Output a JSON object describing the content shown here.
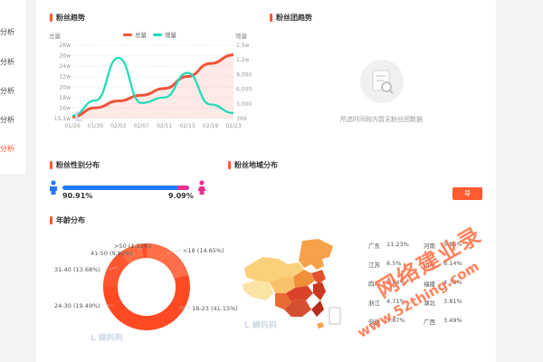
{
  "sidebar": {
    "items": [
      {
        "label": "分析"
      },
      {
        "label": "分析"
      },
      {
        "label": "分析"
      },
      {
        "label": "分析"
      },
      {
        "label": "分析"
      }
    ]
  },
  "sections": {
    "fans_trend": "粉丝趋势",
    "fans_group": "粉丝团趋势",
    "gender": "粉丝性别分布",
    "region": "粉丝地域分布",
    "age": "年龄分布"
  },
  "trend_chart": {
    "left_axis_title": "总量",
    "right_axis_title": "增量",
    "legend_total": "总量",
    "legend_increase": "增量",
    "left_ticks": [
      "28w",
      "26w",
      "24w",
      "22w",
      "20w",
      "18w",
      "16w",
      "15.1w"
    ],
    "right_ticks": [
      "1.5w",
      "1.2w",
      "9,000",
      "6,000",
      "3,000",
      "399"
    ],
    "x_ticks": [
      "01/26",
      "01/30",
      "02/03",
      "02/07",
      "02/11",
      "02/15",
      "02/19",
      "02/23"
    ],
    "colors": {
      "total": "#f0533a",
      "increase": "#21d9b8"
    }
  },
  "fans_group": {
    "empty_message": "所选时间段内暂无粉丝团数据"
  },
  "gender": {
    "male_percent": "90.91%",
    "female_percent": "9.09%",
    "male_value": 90.91,
    "colors": {
      "male": "#1f7bf7",
      "female": "#e8308f"
    }
  },
  "export_button": "导",
  "age": {
    "labels": [
      ">50 (1.21%)",
      "41-50 (9.82%)",
      "31-40 (13.68%)",
      "24-30 (19.49%)",
      "18-23 (41.15%)",
      "<18 (14.65%)"
    ]
  },
  "region_table": [
    {
      "name": "广东",
      "value": "11.23%",
      "name2": "河南",
      "value2": "5.86%"
    },
    {
      "name": "江苏",
      "value": "6.5%",
      "name2": "山东",
      "value2": "6.14%"
    },
    {
      "name": "四川",
      "value": "5.94%",
      "name2": "福建",
      "value2": "4.78%"
    },
    {
      "name": "浙江",
      "value": "4.71%",
      "name2": "湖北",
      "value2": "3.81%"
    },
    {
      "name": "安徽",
      "value": "3.87%",
      "name2": "广西",
      "value2": "3.49%"
    }
  ],
  "watermark": {
    "main": "网络建业录",
    "url": "www.52thing.com"
  },
  "chart_data": {
    "type": "line",
    "x": [
      "01/26",
      "01/30",
      "02/03",
      "02/07",
      "02/11",
      "02/15",
      "02/19",
      "02/23"
    ],
    "series": [
      {
        "name": "总量",
        "values": [
          15.4,
          17.0,
          18.2,
          19.2,
          20.4,
          22.5,
          24.8,
          26.3
        ]
      },
      {
        "name": "增量",
        "values": [
          1000,
          4000,
          12500,
          3500,
          4600,
          9500,
          3200,
          1500
        ]
      }
    ],
    "ylim": [
      15.1,
      28
    ],
    "ylim_right": [
      399,
      15000
    ]
  }
}
